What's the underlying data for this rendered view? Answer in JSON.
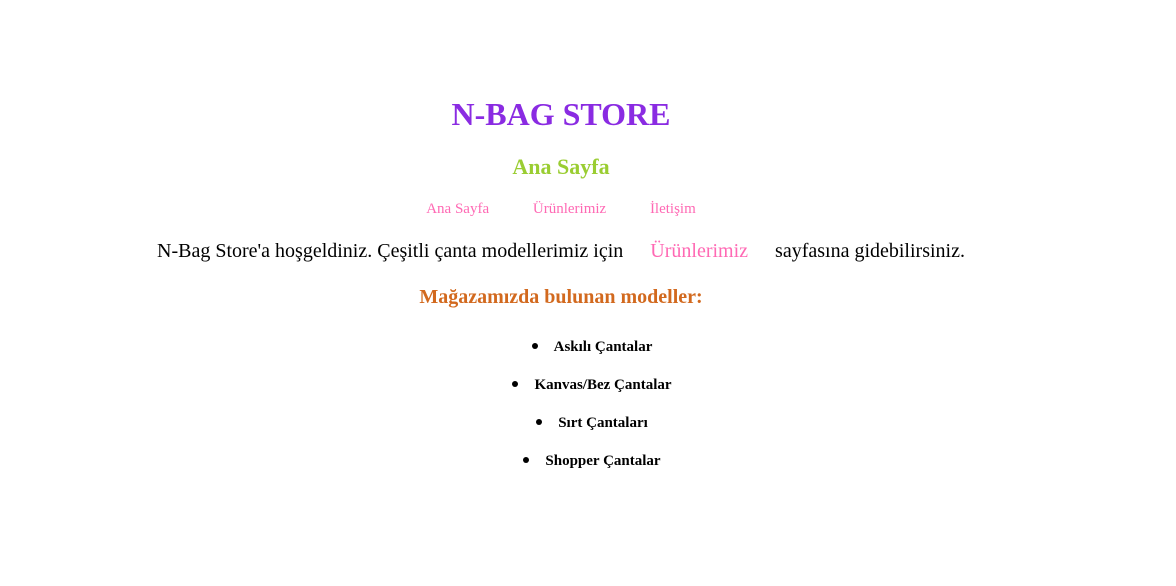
{
  "site": {
    "title": "N-BAG STORE",
    "page_heading": "Ana Sayfa"
  },
  "nav": {
    "items": [
      {
        "label": "Ana Sayfa"
      },
      {
        "label": "Ürünlerimiz"
      },
      {
        "label": "İletişim"
      }
    ]
  },
  "welcome": {
    "before": "N-Bag Store'a hoşgeldiniz. Çeşitli çanta modellerimiz için",
    "link": "Ürünlerimiz",
    "after": "sayfasına gidebilirsiniz."
  },
  "models": {
    "heading": "Mağazamızda bulunan modeller:",
    "items": [
      "Askılı Çantalar",
      "Kanvas/Bez Çantalar",
      "Sırt Çantaları",
      "Shopper Çantalar"
    ]
  },
  "colors": {
    "title": "#8a2be2",
    "page_heading": "#9acd32",
    "links": "#ff69b4",
    "models_heading": "#d2691e"
  }
}
